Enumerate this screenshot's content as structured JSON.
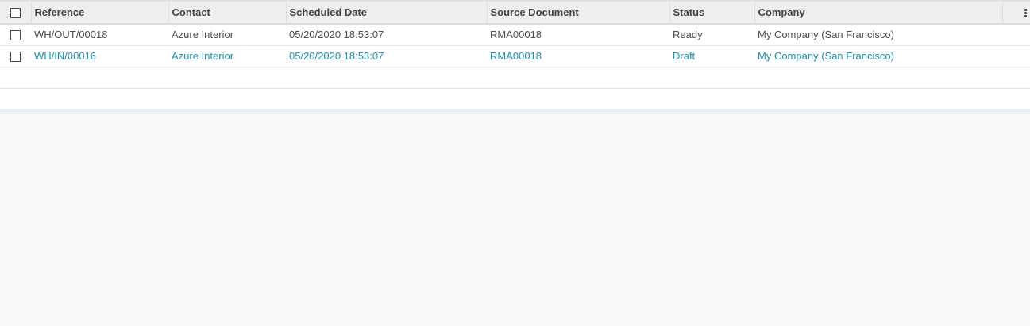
{
  "columns": [
    "Reference",
    "Contact",
    "Scheduled Date",
    "Source Document",
    "Status",
    "Company"
  ],
  "rows": [
    {
      "reference": "WH/OUT/00018",
      "contact": "Azure Interior",
      "scheduled_date": "05/20/2020 18:53:07",
      "source_document": "RMA00018",
      "status": "Ready",
      "company": "My Company (San Francisco)",
      "color": "#4c4c4c"
    },
    {
      "reference": "WH/IN/00016",
      "contact": "Azure Interior",
      "scheduled_date": "05/20/2020 18:53:07",
      "source_document": "RMA00018",
      "status": "Draft",
      "company": "My Company (San Francisco)",
      "color": "#1f8fb0"
    }
  ],
  "icons": {
    "header_checkbox": "checkbox-icon",
    "optional_columns": "kebab-menu-icon"
  }
}
